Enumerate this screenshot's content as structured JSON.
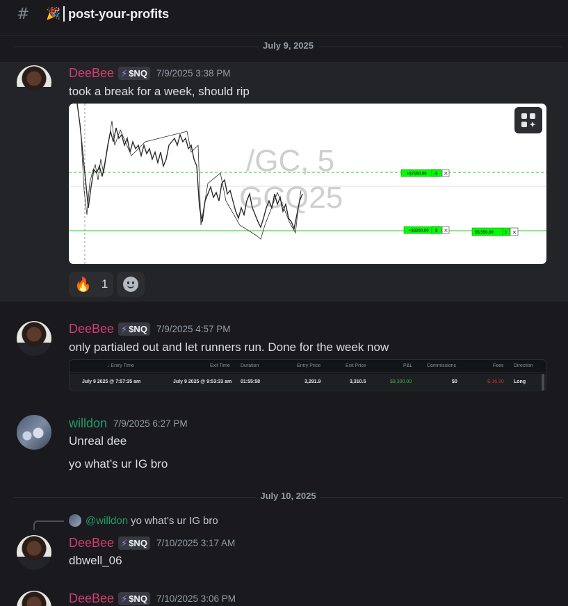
{
  "channel": {
    "icon": "text-channel-hash-icon",
    "emoji": "🎉",
    "name": "post-your-profits"
  },
  "dates": [
    "July 9, 2025",
    "July 10, 2025"
  ],
  "role_tag": "$NQ",
  "messages": [
    {
      "author": "DeeBee",
      "time": "7/9/2025 3:38 PM",
      "text": "took a break for a week, should rip"
    },
    {
      "author": "DeeBee",
      "time": "7/9/2025 4:57 PM",
      "text": "only partialed out and let runners run. Done for the week now"
    },
    {
      "author": "willdon",
      "time": "7/9/2025 6:27 PM",
      "text": "Unreal dee",
      "text2": "yo what’s ur IG bro"
    },
    {
      "author": "DeeBee",
      "time": "7/10/2025 3:17 AM",
      "text": "dbwell_06",
      "reply_mention": "@willdon",
      "reply_text": "yo what’s ur IG bro"
    },
    {
      "author": "DeeBee",
      "time": "7/10/2025 3:06 PM"
    }
  ],
  "chart_image": {
    "watermark_1": "/GC, 5",
    "watermark_2": "GCQ25",
    "orders": [
      "+$7150.00",
      "-$",
      "+$3250.00",
      "$",
      "$5,550.00",
      "1"
    ]
  },
  "reaction": {
    "emoji": "🔥",
    "count": "1"
  },
  "trade_table": {
    "headers": [
      "↓ Entry Time",
      "Exit Time",
      "Duration",
      "Entry Price",
      "Exit Price",
      "P&L",
      "Commissions",
      "Fees",
      "Direction"
    ],
    "row": [
      "July 9 2025 @ 7:57:35 am",
      "July 9 2025 @ 9:53:33 am",
      "01:55:58",
      "3,291.9",
      "3,310.5",
      "$9,300.00",
      "$0",
      "$-16.20",
      "Long"
    ]
  }
}
